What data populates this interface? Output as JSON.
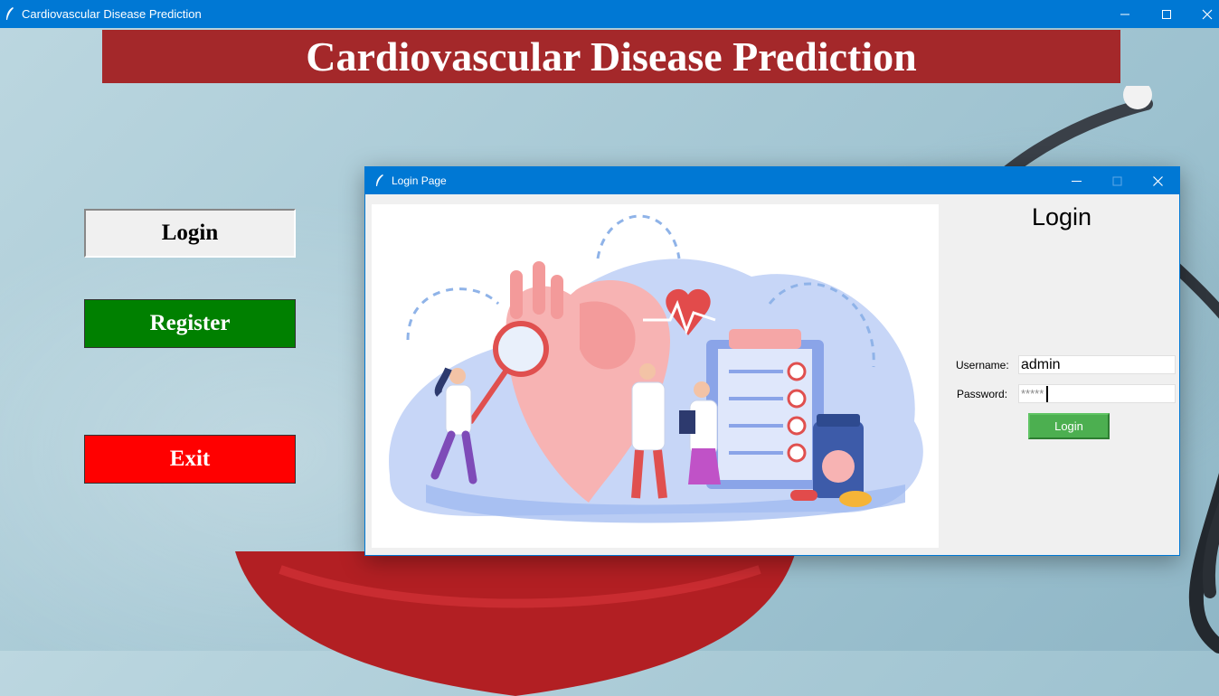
{
  "window": {
    "title": "Cardiovascular Disease Prediction",
    "icon": "feather-icon",
    "controls": [
      "minimize-icon",
      "maximize-icon",
      "close-icon"
    ]
  },
  "header": {
    "title": "Cardiovascular Disease Prediction",
    "background": "#a4282a"
  },
  "sidebar": {
    "login_label": "Login",
    "register_label": "Register",
    "exit_label": "Exit",
    "colors": {
      "login": "#f0f0f0",
      "register": "#008000",
      "exit": "#ff0000"
    }
  },
  "dialog": {
    "title": "Login Page",
    "icon": "feather-icon",
    "heading": "Login",
    "username_label": "Username:",
    "username_value": "admin",
    "password_label": "Password:",
    "password_value": "*****",
    "login_button_label": "Login",
    "login_button_color": "#4caf50",
    "illustration": "heart-doctors-illustration"
  }
}
